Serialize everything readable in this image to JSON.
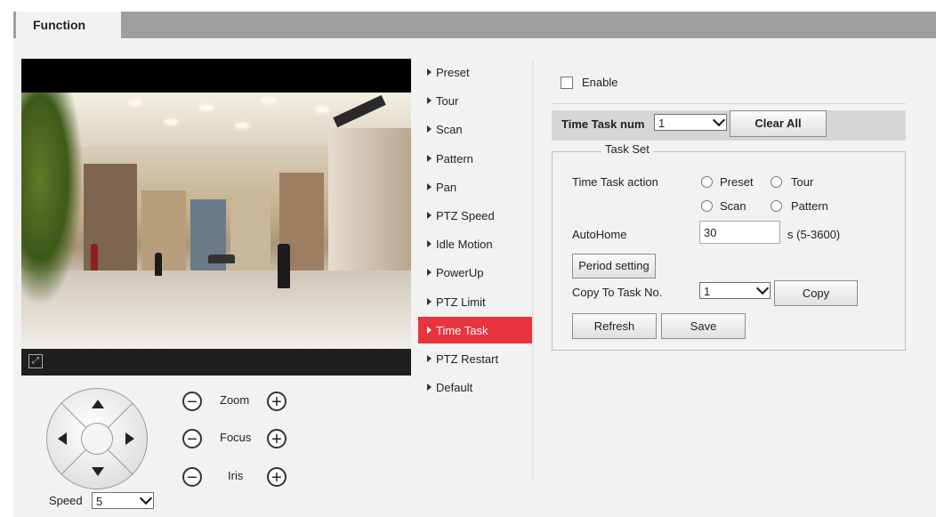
{
  "tab": {
    "label": "Function"
  },
  "menu": {
    "items": [
      {
        "label": "Preset"
      },
      {
        "label": "Tour"
      },
      {
        "label": "Scan"
      },
      {
        "label": "Pattern"
      },
      {
        "label": "Pan"
      },
      {
        "label": "PTZ Speed"
      },
      {
        "label": "Idle Motion"
      },
      {
        "label": "PowerUp"
      },
      {
        "label": "PTZ Limit"
      },
      {
        "label": "Time Task"
      },
      {
        "label": "PTZ Restart"
      },
      {
        "label": "Default"
      }
    ],
    "active": "Time Task"
  },
  "ptz": {
    "zoom_label": "Zoom",
    "focus_label": "Focus",
    "iris_label": "Iris",
    "minus": "−",
    "plus": "+",
    "speed_label": "Speed",
    "speed_value": "5"
  },
  "form": {
    "enable_label": "Enable",
    "enable_checked": false,
    "time_task_num_label": "Time Task num",
    "time_task_num_value": "1",
    "clear_all_label": "Clear All",
    "task_set_legend": "Task Set",
    "time_task_action_label": "Time Task action",
    "actions": {
      "preset": "Preset",
      "tour": "Tour",
      "scan": "Scan",
      "pattern": "Pattern"
    },
    "autohome_label": "AutoHome",
    "autohome_value": "30",
    "autohome_range": "s (5-3600)",
    "period_setting_label": "Period setting",
    "copy_to_label": "Copy To Task No.",
    "copy_to_value": "1",
    "copy_label": "Copy",
    "refresh_label": "Refresh",
    "save_label": "Save"
  },
  "colors": {
    "active_menu": "#e8343f",
    "tab_bar": "#9e9e9e",
    "panel_bg": "#f2f2f2"
  }
}
